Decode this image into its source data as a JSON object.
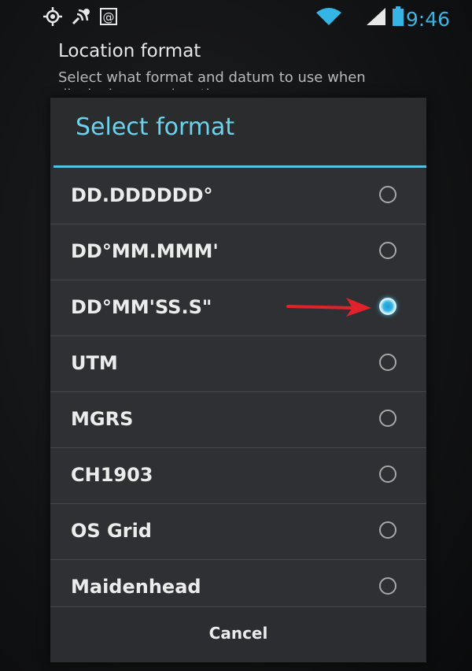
{
  "status_bar": {
    "time": "9:46",
    "accent_color": "#35b5e5",
    "left_icons": [
      "gps-icon",
      "notification-icon",
      "email-icon"
    ],
    "right_icons": [
      "wifi-icon",
      "signal-icon",
      "battery-icon"
    ]
  },
  "background": {
    "setting_title": "Location format",
    "setting_summary": "Select what format and datum to use when displaying your location"
  },
  "dialog": {
    "title": "Select format",
    "options": [
      {
        "label": "DD.DDDDDD°",
        "selected": false
      },
      {
        "label": "DD°MM.MMM'",
        "selected": false
      },
      {
        "label": "DD°MM'SS.S\"",
        "selected": true
      },
      {
        "label": "UTM",
        "selected": false
      },
      {
        "label": "MGRS",
        "selected": false
      },
      {
        "label": "CH1903",
        "selected": false
      },
      {
        "label": "OS Grid",
        "selected": false
      },
      {
        "label": "Maidenhead",
        "selected": false
      }
    ],
    "cancel_label": "Cancel",
    "annotation": "red-arrow-icon",
    "annotation_color": "#e0232a"
  }
}
